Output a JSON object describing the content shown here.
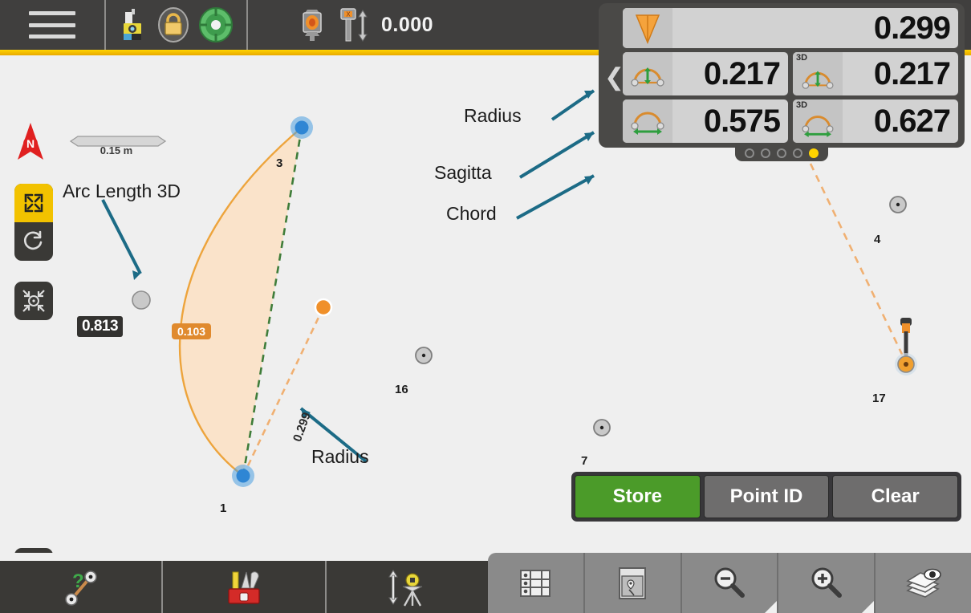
{
  "topbar": {
    "menu_icon": "hamburger-menu-icon",
    "instrument_icon": "total-station-icon",
    "lock_icon": "padlock-locked-icon",
    "target_icon": "target-lock-icon",
    "prism_icon": "prism-target-icon",
    "pole_icon": "pole-height-icon",
    "height_value": "0.000"
  },
  "map": {
    "north_icon": "north-arrow-icon",
    "scale_label": "0.15 m",
    "fit_icon": "fit-to-screen-icon",
    "rotate_icon": "rotate-refresh-icon",
    "center_icon": "center-on-position-icon",
    "map_view_icon": "map-pin-frame-icon",
    "arc_length_badge": "0.813",
    "sagitta_badge": "0.103",
    "radius_label": "0.299",
    "points": [
      {
        "id": "3",
        "type": "measured-blue"
      },
      {
        "id": "1",
        "type": "measured-blue"
      },
      {
        "id": "16",
        "type": "known-gray"
      },
      {
        "id": "7",
        "type": "known-gray"
      },
      {
        "id": "4",
        "type": "known-gray"
      },
      {
        "id": "17",
        "type": "pole-orange"
      }
    ],
    "colors": {
      "arc": "#eda43c",
      "fill": "#fae3ca",
      "chord": "#3f7d3a",
      "radius": "#f0b072",
      "accent_yellow": "#ffd400",
      "store_green": "#4b9b29"
    }
  },
  "annotations": [
    {
      "id": "arc-length-3d",
      "text": "Arc Length 3D"
    },
    {
      "id": "radius-top",
      "text": "Radius"
    },
    {
      "id": "sagitta",
      "text": "Sagitta"
    },
    {
      "id": "chord",
      "text": "Chord"
    },
    {
      "id": "radius-map",
      "text": "Radius"
    }
  ],
  "panel": {
    "collapse_icon": "chevron-left-icon",
    "fields": [
      {
        "icon": "radius-wedge-icon",
        "label_3d": "",
        "value": "0.299"
      },
      {
        "icon": "sagitta-arc-icon",
        "label_3d": "",
        "value": "0.217"
      },
      {
        "icon": "sagitta-arc-icon",
        "label_3d": "3D",
        "value": "0.217"
      },
      {
        "icon": "chord-arc-icon",
        "label_3d": "",
        "value": "0.575"
      },
      {
        "icon": "chord-arc-icon",
        "label_3d": "3D",
        "value": "0.627"
      }
    ],
    "page_dots": 5,
    "active_dot": 5
  },
  "actions": {
    "store": "Store",
    "point_id": "Point ID",
    "clear": "Clear"
  },
  "bottom_left_toolbar": [
    {
      "icon": "measure-distance-icon"
    },
    {
      "icon": "toolbox-icon"
    },
    {
      "icon": "station-setup-icon"
    }
  ],
  "bottom_right_toolbar": [
    {
      "icon": "table-list-icon"
    },
    {
      "icon": "map-view-icon"
    },
    {
      "icon": "zoom-out-icon"
    },
    {
      "icon": "zoom-in-icon"
    },
    {
      "icon": "layers-icon"
    }
  ]
}
